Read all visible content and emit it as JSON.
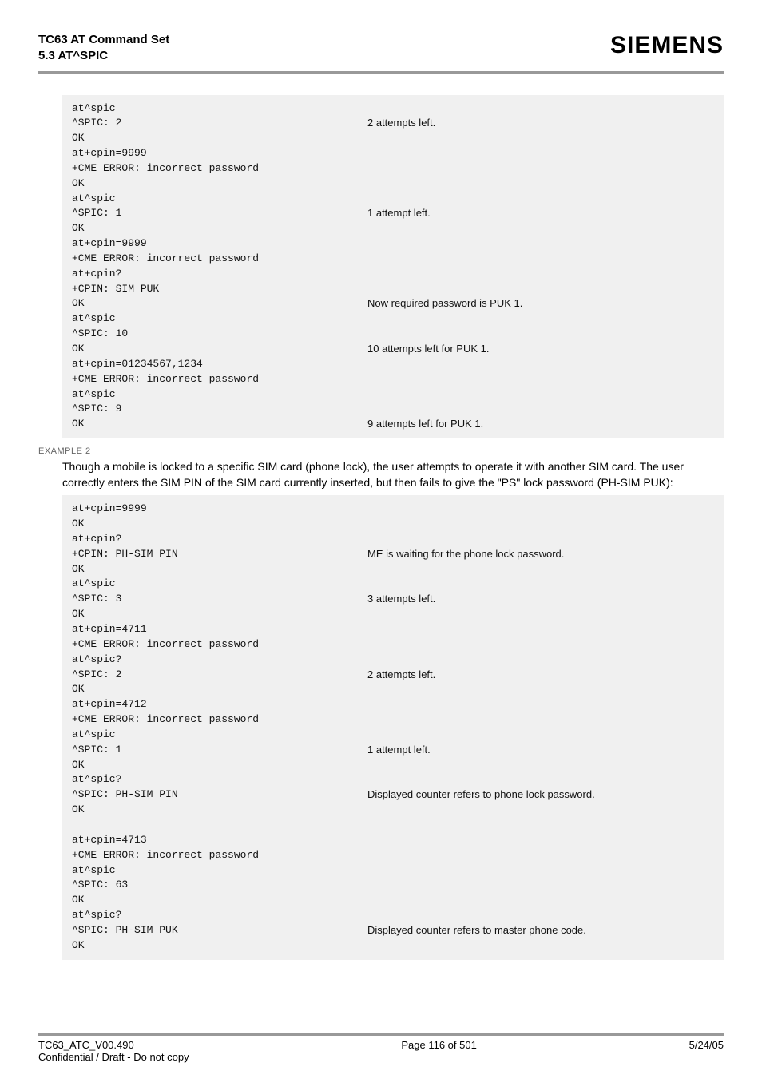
{
  "header": {
    "title_line1": "TC63 AT Command Set",
    "title_line2": "5.3 AT^SPIC",
    "brand": "SIEMENS"
  },
  "block1": {
    "rows": [
      {
        "left": "at^spic",
        "right": ""
      },
      {
        "left": "^SPIC: 2",
        "right": "2 attempts left."
      },
      {
        "left": "OK",
        "right": ""
      },
      {
        "left": "at+cpin=9999",
        "right": ""
      },
      {
        "left": "+CME ERROR: incorrect password",
        "right": ""
      },
      {
        "left": "OK",
        "right": ""
      },
      {
        "left": "at^spic",
        "right": ""
      },
      {
        "left": "^SPIC: 1",
        "right": "1 attempt left."
      },
      {
        "left": "OK",
        "right": ""
      },
      {
        "left": "at+cpin=9999",
        "right": ""
      },
      {
        "left": "+CME ERROR: incorrect password",
        "right": ""
      },
      {
        "left": "at+cpin?",
        "right": ""
      },
      {
        "left": "+CPIN: SIM PUK",
        "right": ""
      },
      {
        "left": "OK",
        "right": "Now required password is PUK 1."
      },
      {
        "left": "at^spic",
        "right": ""
      },
      {
        "left": "^SPIC: 10",
        "right": ""
      },
      {
        "left": "OK",
        "right": "10 attempts left for PUK 1."
      },
      {
        "left": "at+cpin=01234567,1234",
        "right": ""
      },
      {
        "left": "+CME ERROR: incorrect password",
        "right": ""
      },
      {
        "left": "at^spic",
        "right": ""
      },
      {
        "left": "^SPIC: 9",
        "right": ""
      },
      {
        "left": "OK",
        "right": "9 attempts left for PUK 1."
      }
    ]
  },
  "example2_label": "EXAMPLE 2",
  "example2_text": "Though a mobile is locked to a specific SIM card (phone lock), the user attempts to operate it with another SIM card. The user correctly enters the SIM PIN of the SIM card currently inserted, but then fails to give the \"PS\" lock password (PH-SIM PUK):",
  "block2": {
    "rows": [
      {
        "left": "at+cpin=9999",
        "right": ""
      },
      {
        "left": "OK",
        "right": ""
      },
      {
        "left": "at+cpin?",
        "right": ""
      },
      {
        "left": "+CPIN: PH-SIM PIN",
        "right": "ME is waiting for the phone lock password."
      },
      {
        "left": "OK",
        "right": ""
      },
      {
        "left": "at^spic",
        "right": ""
      },
      {
        "left": "^SPIC: 3",
        "right": "3 attempts left."
      },
      {
        "left": "OK",
        "right": ""
      },
      {
        "left": "at+cpin=4711",
        "right": ""
      },
      {
        "left": "+CME ERROR: incorrect password",
        "right": ""
      },
      {
        "left": "at^spic?",
        "right": ""
      },
      {
        "left": "^SPIC: 2",
        "right": "2 attempts left."
      },
      {
        "left": "OK",
        "right": ""
      },
      {
        "left": "at+cpin=4712",
        "right": ""
      },
      {
        "left": "+CME ERROR: incorrect password",
        "right": ""
      },
      {
        "left": "at^spic",
        "right": ""
      },
      {
        "left": "^SPIC: 1",
        "right": "1 attempt left."
      },
      {
        "left": "OK",
        "right": ""
      },
      {
        "left": "at^spic?",
        "right": ""
      },
      {
        "left": "^SPIC: PH-SIM PIN",
        "right": "Displayed counter refers to phone lock password."
      },
      {
        "left": "OK",
        "right": ""
      },
      {
        "left": "",
        "right": ""
      },
      {
        "left": "at+cpin=4713",
        "right": ""
      },
      {
        "left": "+CME ERROR: incorrect password",
        "right": ""
      },
      {
        "left": "at^spic",
        "right": ""
      },
      {
        "left": "^SPIC: 63",
        "right": ""
      },
      {
        "left": "OK",
        "right": ""
      },
      {
        "left": "at^spic?",
        "right": ""
      },
      {
        "left": "^SPIC: PH-SIM PUK",
        "right": "Displayed counter refers to master phone code."
      },
      {
        "left": "OK",
        "right": ""
      }
    ]
  },
  "footer": {
    "left_line1": "TC63_ATC_V00.490",
    "left_line2": "Confidential / Draft - Do not copy",
    "center": "Page 116 of 501",
    "right": "5/24/05"
  }
}
